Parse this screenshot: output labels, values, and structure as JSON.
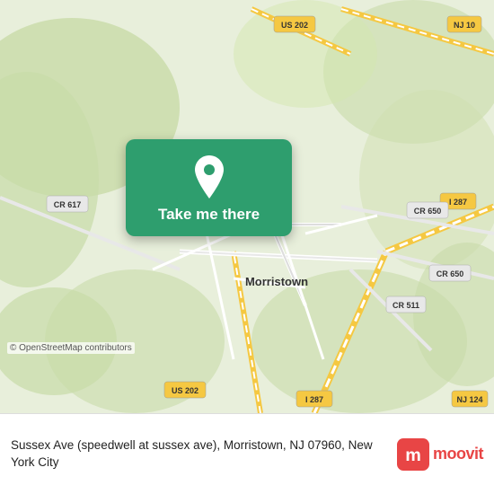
{
  "map": {
    "alt": "Map of Morristown, NJ area",
    "credit": "© OpenStreetMap contributors",
    "road_labels": [
      "US 202",
      "NJ 10",
      "I 287",
      "CR 650",
      "CR 617",
      "CR 511",
      "I 287",
      "US 202"
    ],
    "city_label": "Morristown"
  },
  "button": {
    "label": "Take me there",
    "pin_icon": "map-pin"
  },
  "bottom_bar": {
    "address": "Sussex Ave (speedwell at sussex ave), Morristown,\nNJ 07960, New York City"
  },
  "branding": {
    "name": "moovit",
    "icon_color": "#e84545"
  }
}
